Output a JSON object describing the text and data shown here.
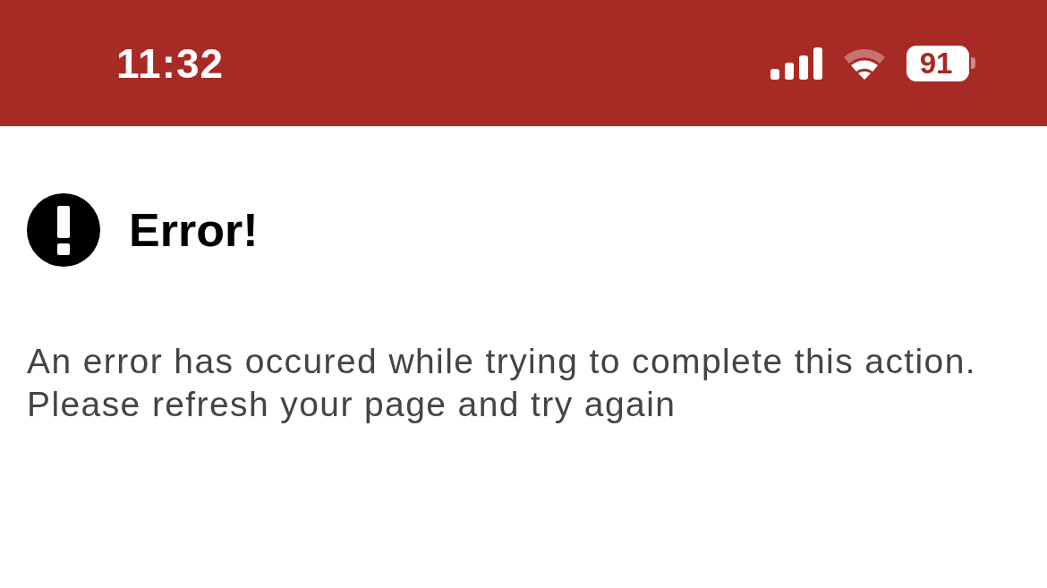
{
  "status_bar": {
    "time": "11:32",
    "battery": "91"
  },
  "error": {
    "title": "Error!",
    "message": "An error has occured while trying to complete this action. Please refresh your page and try again"
  }
}
